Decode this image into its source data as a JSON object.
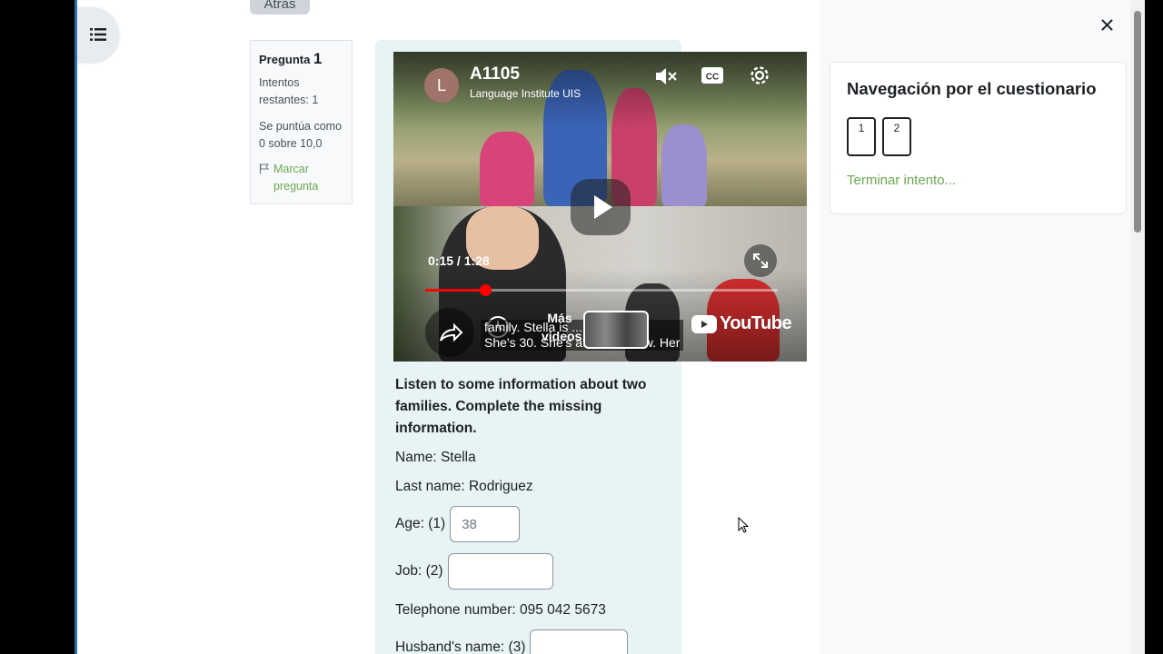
{
  "back_button": {
    "label": "Atrás"
  },
  "question_info": {
    "label": "Pregunta",
    "number": "1",
    "attempts": "Intentos restantes: 1",
    "marks": "Se puntúa como 0 sobre 10,0",
    "flag_label": "Marcar pregunta"
  },
  "video": {
    "channel_avatar": "L",
    "title": "A1105",
    "channel": "Language Institute UIS",
    "current_time": "0:15",
    "duration": "1:28",
    "progress_fraction": 0.17,
    "more_videos": "Más videos",
    "caption_line1": "family. Stella is ... teacher.",
    "caption_line2": "She's 30. She's at school now. Her",
    "youtube_label": "YouTube",
    "icons": [
      "mute-icon",
      "captions-icon",
      "settings-icon",
      "play-icon",
      "fullscreen-icon",
      "share-icon",
      "watch-later-icon"
    ]
  },
  "question": {
    "prompt": "Listen to some information about two families. Complete the missing information.",
    "name": "Name: Stella",
    "last_name": "Last name: Rodriguez",
    "age_label": "Age: (1)",
    "age_value": "38",
    "job_label": "Job: (2)",
    "job_value": "",
    "telephone": "Telephone number: 095 042 5673",
    "husband_label": "Husband's name: (3)",
    "husband_value": ""
  },
  "navigation": {
    "title": "Navegación por el cuestionario",
    "questions": [
      "1",
      "2"
    ],
    "finish_link": "Terminar intento..."
  },
  "colors": {
    "link_green": "#6aa84f",
    "question_bg": "#e7f3f5",
    "progress_red": "#ff0000"
  }
}
